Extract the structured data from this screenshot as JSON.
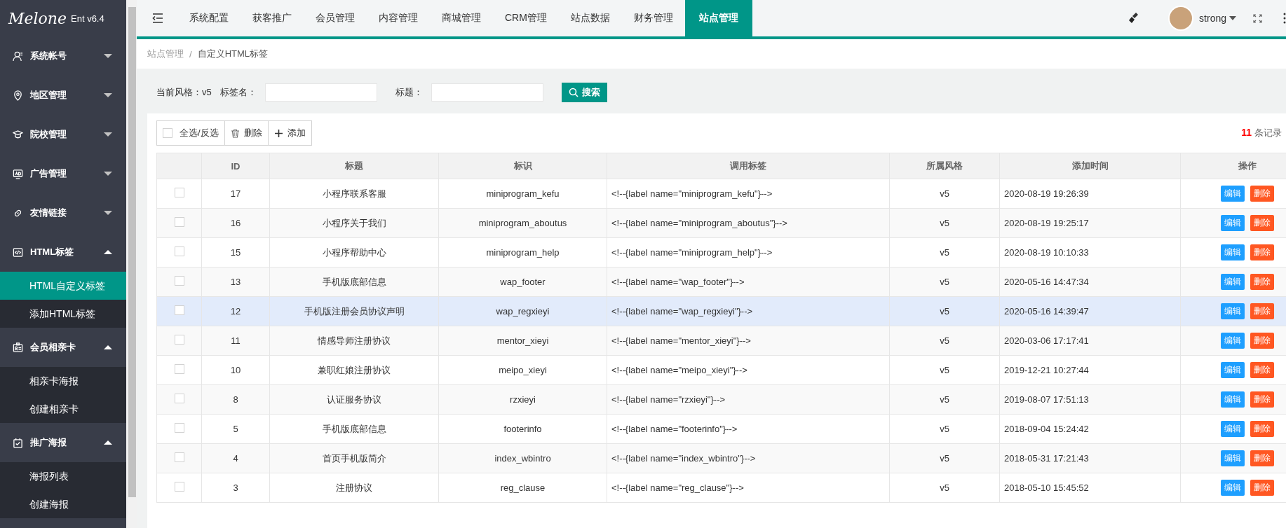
{
  "logo": {
    "script": "Melone",
    "version": "Ent v6.4"
  },
  "sidebar": {
    "groups": [
      {
        "label": "系统帐号",
        "expanded": false
      },
      {
        "label": "地区管理",
        "expanded": false
      },
      {
        "label": "院校管理",
        "expanded": false
      },
      {
        "label": "广告管理",
        "expanded": false
      },
      {
        "label": "友情链接",
        "expanded": false
      },
      {
        "label": "HTML标签",
        "expanded": true,
        "children": [
          {
            "label": "HTML自定义标签",
            "selected": true
          },
          {
            "label": "添加HTML标签",
            "selected": false
          }
        ]
      },
      {
        "label": "会员相亲卡",
        "expanded": true,
        "children": [
          {
            "label": "相亲卡海报",
            "selected": false
          },
          {
            "label": "创建相亲卡",
            "selected": false
          }
        ]
      },
      {
        "label": "推广海报",
        "expanded": true,
        "children": [
          {
            "label": "海报列表",
            "selected": false
          },
          {
            "label": "创建海报",
            "selected": false
          }
        ]
      }
    ]
  },
  "topnav": {
    "items": [
      {
        "label": "系统配置",
        "selected": false
      },
      {
        "label": "获客推广",
        "selected": false
      },
      {
        "label": "会员管理",
        "selected": false
      },
      {
        "label": "内容管理",
        "selected": false
      },
      {
        "label": "商城管理",
        "selected": false
      },
      {
        "label": "CRM管理",
        "selected": false
      },
      {
        "label": "站点数据",
        "selected": false
      },
      {
        "label": "财务管理",
        "selected": false
      },
      {
        "label": "站点管理",
        "selected": true
      }
    ],
    "user": "strong"
  },
  "breadcrumb": {
    "parent": "站点管理",
    "separator": "/",
    "current": "自定义HTML标签"
  },
  "filters": {
    "style_label": "当前风格：v5",
    "name_label": "标签名：",
    "title_label": "标题：",
    "search_button": "搜索"
  },
  "toolbar": {
    "select_all": "全选/反选",
    "delete": "删除",
    "add": "添加"
  },
  "record_count": {
    "count": "11",
    "suffix": "条记录"
  },
  "table": {
    "columns": [
      "ID",
      "标题",
      "标识",
      "调用标签",
      "所属风格",
      "添加时间",
      "操作"
    ],
    "rows": [
      {
        "id": "17",
        "title": "小程序联系客服",
        "key": "miniprogram_kefu",
        "tag": "<!--{label name=\"miniprogram_kefu\"}-->",
        "style": "v5",
        "time": "2020-08-19 19:26:39",
        "edit": "编辑",
        "delete": "删除",
        "checked": false,
        "hovered": false
      },
      {
        "id": "16",
        "title": "小程序关于我们",
        "key": "miniprogram_aboutus",
        "tag": "<!--{label name=\"miniprogram_aboutus\"}-->",
        "style": "v5",
        "time": "2020-08-19 19:25:17",
        "edit": "编辑",
        "delete": "删除",
        "checked": false,
        "hovered": false
      },
      {
        "id": "15",
        "title": "小程序帮助中心",
        "key": "miniprogram_help",
        "tag": "<!--{label name=\"miniprogram_help\"}-->",
        "style": "v5",
        "time": "2020-08-19 10:10:33",
        "edit": "编辑",
        "delete": "删除",
        "checked": false,
        "hovered": false
      },
      {
        "id": "13",
        "title": "手机版底部信息",
        "key": "wap_footer",
        "tag": "<!--{label name=\"wap_footer\"}-->",
        "style": "v5",
        "time": "2020-05-16 14:47:34",
        "edit": "编辑",
        "delete": "删除",
        "checked": false,
        "hovered": false
      },
      {
        "id": "12",
        "title": "手机版注册会员协议声明",
        "key": "wap_regxieyi",
        "tag": "<!--{label name=\"wap_regxieyi\"}-->",
        "style": "v5",
        "time": "2020-05-16 14:39:47",
        "edit": "编辑",
        "delete": "删除",
        "checked": false,
        "hovered": true
      },
      {
        "id": "11",
        "title": "情感导师注册协议",
        "key": "mentor_xieyi",
        "tag": "<!--{label name=\"mentor_xieyi\"}-->",
        "style": "v5",
        "time": "2020-03-06 17:17:41",
        "edit": "编辑",
        "delete": "删除",
        "checked": false,
        "hovered": false
      },
      {
        "id": "10",
        "title": "兼职红娘注册协议",
        "key": "meipo_xieyi",
        "tag": "<!--{label name=\"meipo_xieyi\"}-->",
        "style": "v5",
        "time": "2019-12-21 10:27:44",
        "edit": "编辑",
        "delete": "删除",
        "checked": false,
        "hovered": false
      },
      {
        "id": "8",
        "title": "认证服务协议",
        "key": "rzxieyi",
        "tag": "<!--{label name=\"rzxieyi\"}-->",
        "style": "v5",
        "time": "2019-08-07 17:51:13",
        "edit": "编辑",
        "delete": "删除",
        "checked": false,
        "hovered": false
      },
      {
        "id": "5",
        "title": "手机版底部信息",
        "key": "footerinfo",
        "tag": "<!--{label name=\"footerinfo\"}-->",
        "style": "v5",
        "time": "2018-09-04 15:24:42",
        "edit": "编辑",
        "delete": "删除",
        "checked": false,
        "hovered": false
      },
      {
        "id": "4",
        "title": "首页手机版简介",
        "key": "index_wbintro",
        "tag": "<!--{label name=\"index_wbintro\"}-->",
        "style": "v5",
        "time": "2018-05-31 17:21:43",
        "edit": "编辑",
        "delete": "删除",
        "checked": false,
        "hovered": false
      },
      {
        "id": "3",
        "title": "注册协议",
        "key": "reg_clause",
        "tag": "<!--{label name=\"reg_clause\"}-->",
        "style": "v5",
        "time": "2018-05-10 15:45:52",
        "edit": "编辑",
        "delete": "删除",
        "checked": false,
        "hovered": false
      }
    ]
  }
}
